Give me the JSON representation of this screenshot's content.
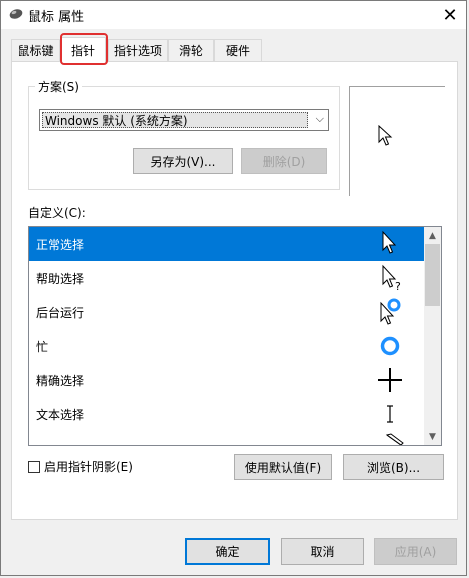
{
  "window": {
    "title": "鼠标 属性",
    "close": "✕"
  },
  "tabs": [
    {
      "label": "鼠标键"
    },
    {
      "label": "指针"
    },
    {
      "label": "指针选项"
    },
    {
      "label": "滑轮"
    },
    {
      "label": "硬件"
    }
  ],
  "scheme": {
    "label": "方案(S)",
    "selected": "Windows 默认 (系统方案)",
    "save_as": "另存为(V)...",
    "delete": "删除(D)"
  },
  "custom": {
    "label": "自定义(C):",
    "items": [
      {
        "label": "正常选择",
        "icon": "arrow-cursor-icon"
      },
      {
        "label": "帮助选择",
        "icon": "help-cursor-icon"
      },
      {
        "label": "后台运行",
        "icon": "working-background-cursor-icon"
      },
      {
        "label": "忙",
        "icon": "busy-cursor-icon"
      },
      {
        "label": "精确选择",
        "icon": "crosshair-cursor-icon"
      },
      {
        "label": "文本选择",
        "icon": "text-beam-cursor-icon"
      }
    ]
  },
  "shadow": {
    "label": "启用指针阴影(E)"
  },
  "use_default": "使用默认值(F)",
  "browse": "浏览(B)...",
  "footer": {
    "ok": "确定",
    "cancel": "取消",
    "apply": "应用(A)"
  },
  "colors": {
    "accent": "#0078d7",
    "highlight": "#e03030"
  }
}
